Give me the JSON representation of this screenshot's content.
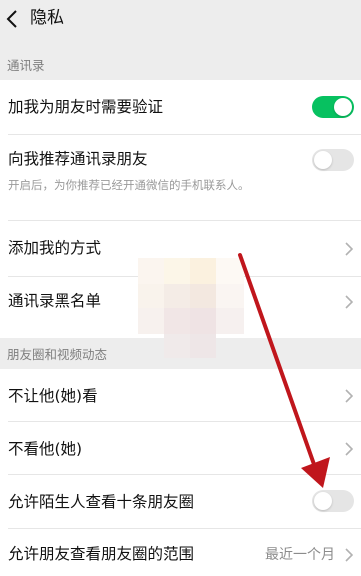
{
  "header": {
    "title": "隐私",
    "back_icon": "chevron-left-icon"
  },
  "sections": {
    "contacts": {
      "label": "通讯录",
      "rows": [
        {
          "label": "加我为朋友时需要验证",
          "control": "toggle",
          "enabled": true
        },
        {
          "label": "向我推荐通讯录朋友",
          "subtitle": "开启后，为你推荐已经开通微信的手机联系人。",
          "control": "toggle",
          "enabled": false
        },
        {
          "label": "添加我的方式",
          "control": "chevron-right-icon"
        },
        {
          "label": "通讯录黑名单",
          "control": "chevron-right-icon"
        }
      ]
    },
    "moments": {
      "label": "朋友圈和视频动态",
      "rows": [
        {
          "label": "不让他(她)看",
          "control": "chevron-right-icon"
        },
        {
          "label": "不看他(她)",
          "control": "chevron-right-icon"
        },
        {
          "label": "允许陌生人查看十条朋友圈",
          "control": "toggle",
          "enabled": false
        },
        {
          "label": "允许朋友查看朋友圈的范围",
          "value": "最近一个月",
          "control": "chevron-right-icon"
        }
      ]
    }
  },
  "colors": {
    "background": "#ededed",
    "toggle_on": "#07c160",
    "toggle_off": "#e5e5e5",
    "annotation_arrow": "#c0161c"
  }
}
